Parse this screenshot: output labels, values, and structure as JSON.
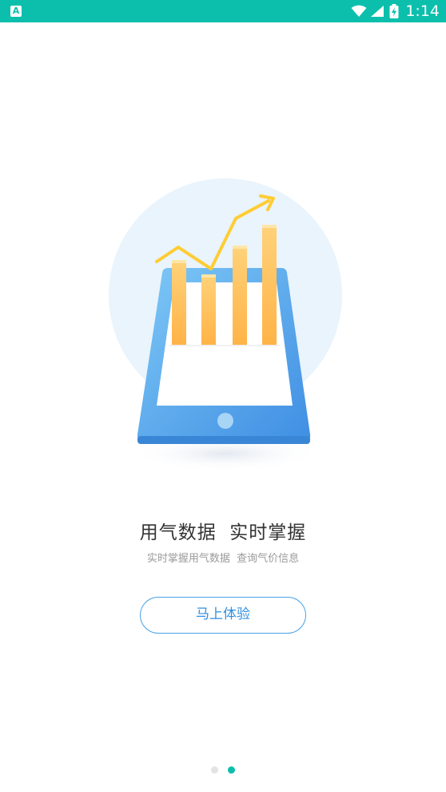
{
  "status_bar": {
    "app_icon_letter": "A",
    "time": "1:14",
    "color": "#0bbfac"
  },
  "onboarding": {
    "headline": "用气数据  实时掌握",
    "subline": "实时掌握用气数据  查询气价信息",
    "cta_label": "马上体验",
    "accent_color": "#2f8fe0",
    "page_count": 2,
    "current_page": 2
  }
}
